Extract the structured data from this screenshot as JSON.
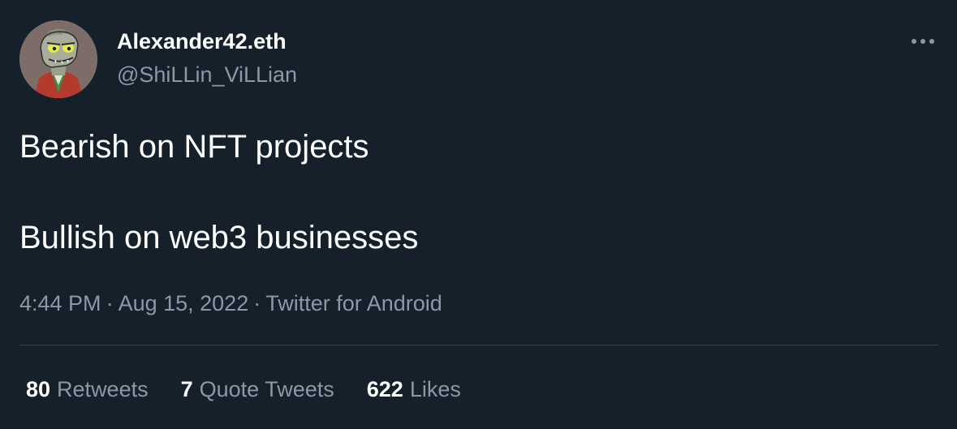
{
  "colors": {
    "background": "#15202b",
    "primary_text": "#ffffff",
    "secondary_text": "#8b98a5",
    "divider": "#38444d"
  },
  "author": {
    "display_name": "Alexander42.eth",
    "handle": "@ShiLLin_ViLLian",
    "avatar_icon": "lizard-avatar"
  },
  "more_icon": "more-horizontal-icon",
  "tweet": {
    "lines": [
      "Bearish on NFT projects",
      "Bullish on web3 businesses"
    ]
  },
  "meta": {
    "time": "4:44 PM",
    "separator": "·",
    "date": "Aug 15, 2022",
    "source": "Twitter for Android"
  },
  "stats": {
    "retweets_count": "80",
    "retweets_label": "Retweets",
    "quotes_count": "7",
    "quotes_label": "Quote Tweets",
    "likes_count": "622",
    "likes_label": "Likes"
  }
}
